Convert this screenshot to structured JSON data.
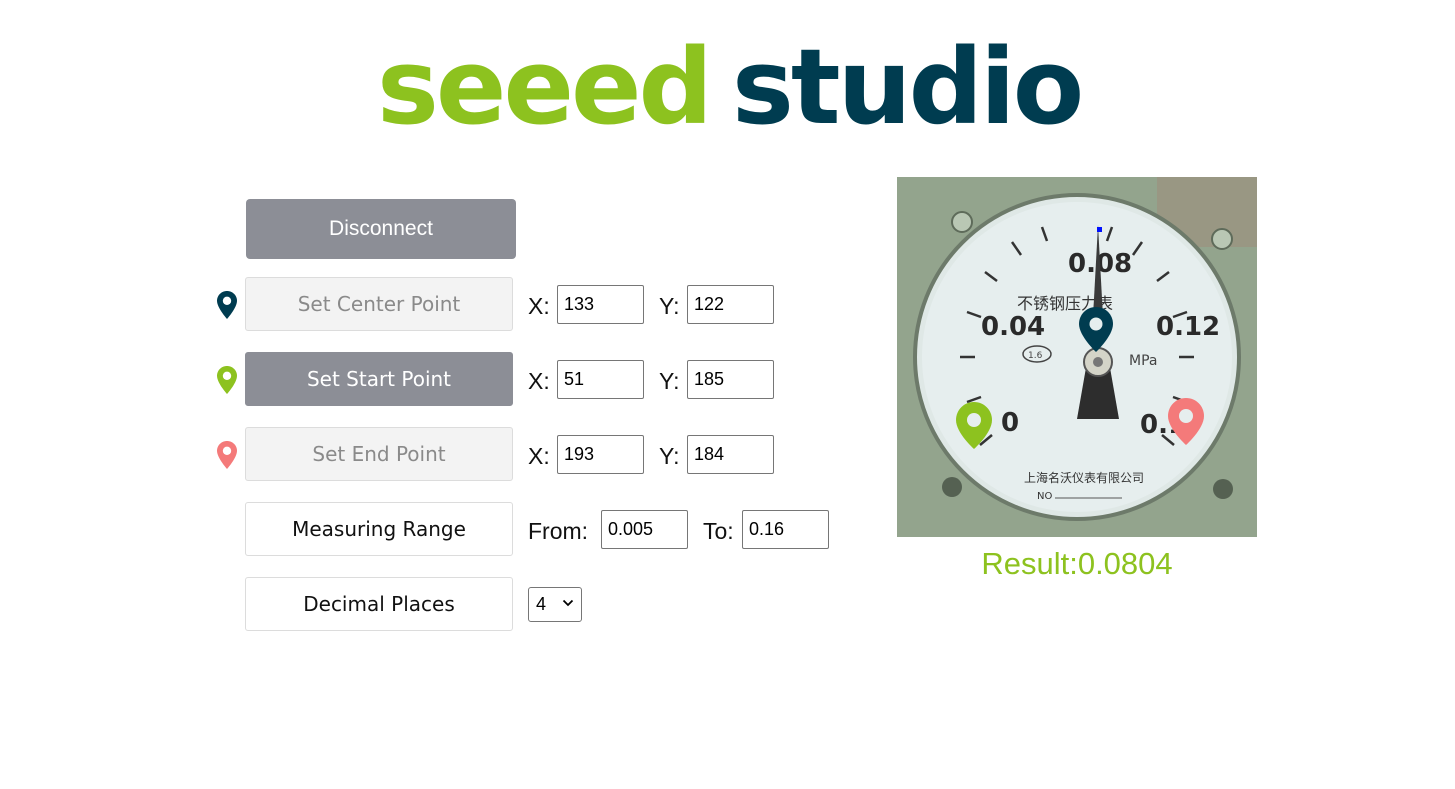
{
  "logo": {
    "part1": "seeed",
    "part2": "studio",
    "color1": "#8dc21f",
    "color2": "#003c50"
  },
  "controls": {
    "disconnect_label": "Disconnect",
    "center": {
      "label": "Set Center Point",
      "icon": "map-pin-icon",
      "color": "#003c50",
      "x_label": "X:",
      "x_value": "133",
      "y_label": "Y:",
      "y_value": "122"
    },
    "start": {
      "label": "Set Start Point",
      "icon": "map-pin-icon",
      "color": "#8dc21f",
      "x_label": "X:",
      "x_value": "51",
      "y_label": "Y:",
      "y_value": "185"
    },
    "end": {
      "label": "Set End Point",
      "icon": "map-pin-icon",
      "color": "#f47a7a",
      "x_label": "X:",
      "x_value": "193",
      "y_label": "Y:",
      "y_value": "184"
    },
    "range": {
      "label": "Measuring Range",
      "from_label": "From:",
      "from_value": "0.005",
      "to_label": "To:",
      "to_value": "0.16"
    },
    "decimal": {
      "label": "Decimal Places",
      "selected": "4"
    }
  },
  "gauge": {
    "tick_labels": [
      "0",
      "0.04",
      "0.08",
      "0.12",
      "0.1"
    ],
    "face_text": "不锈钢压力表",
    "unit": "MPa",
    "maker_text": "上海名沃仪表有限公司",
    "serial_text": "NO",
    "badge_text": "1.6"
  },
  "result": {
    "text": "Result:0.0804",
    "color": "#8dc21f"
  }
}
